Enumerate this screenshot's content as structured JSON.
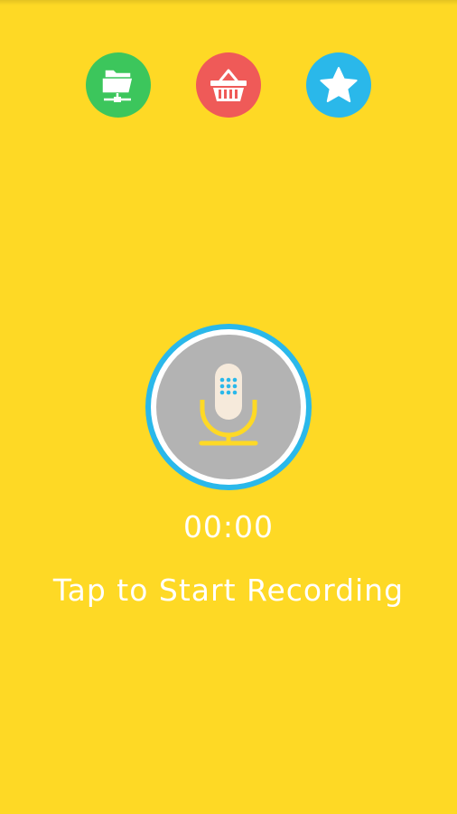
{
  "colors": {
    "background": "#fed925",
    "files_button": "#3cc65c",
    "basket_button": "#ef5a58",
    "star_button": "#2ab8ea",
    "record_ring": "#2ab8ea",
    "record_disc": "#b3b3b3",
    "mic_body": "#f6eadb",
    "mic_dots": "#2ab8ea",
    "mic_stand": "#fed925",
    "text": "#ffffff"
  },
  "toolbar": {
    "files_icon": "folder-network-icon",
    "basket_icon": "shopping-basket-icon",
    "star_icon": "star-icon"
  },
  "recorder": {
    "icon": "microphone-icon",
    "timer": "00:00",
    "hint": "Tap to Start Recording"
  }
}
